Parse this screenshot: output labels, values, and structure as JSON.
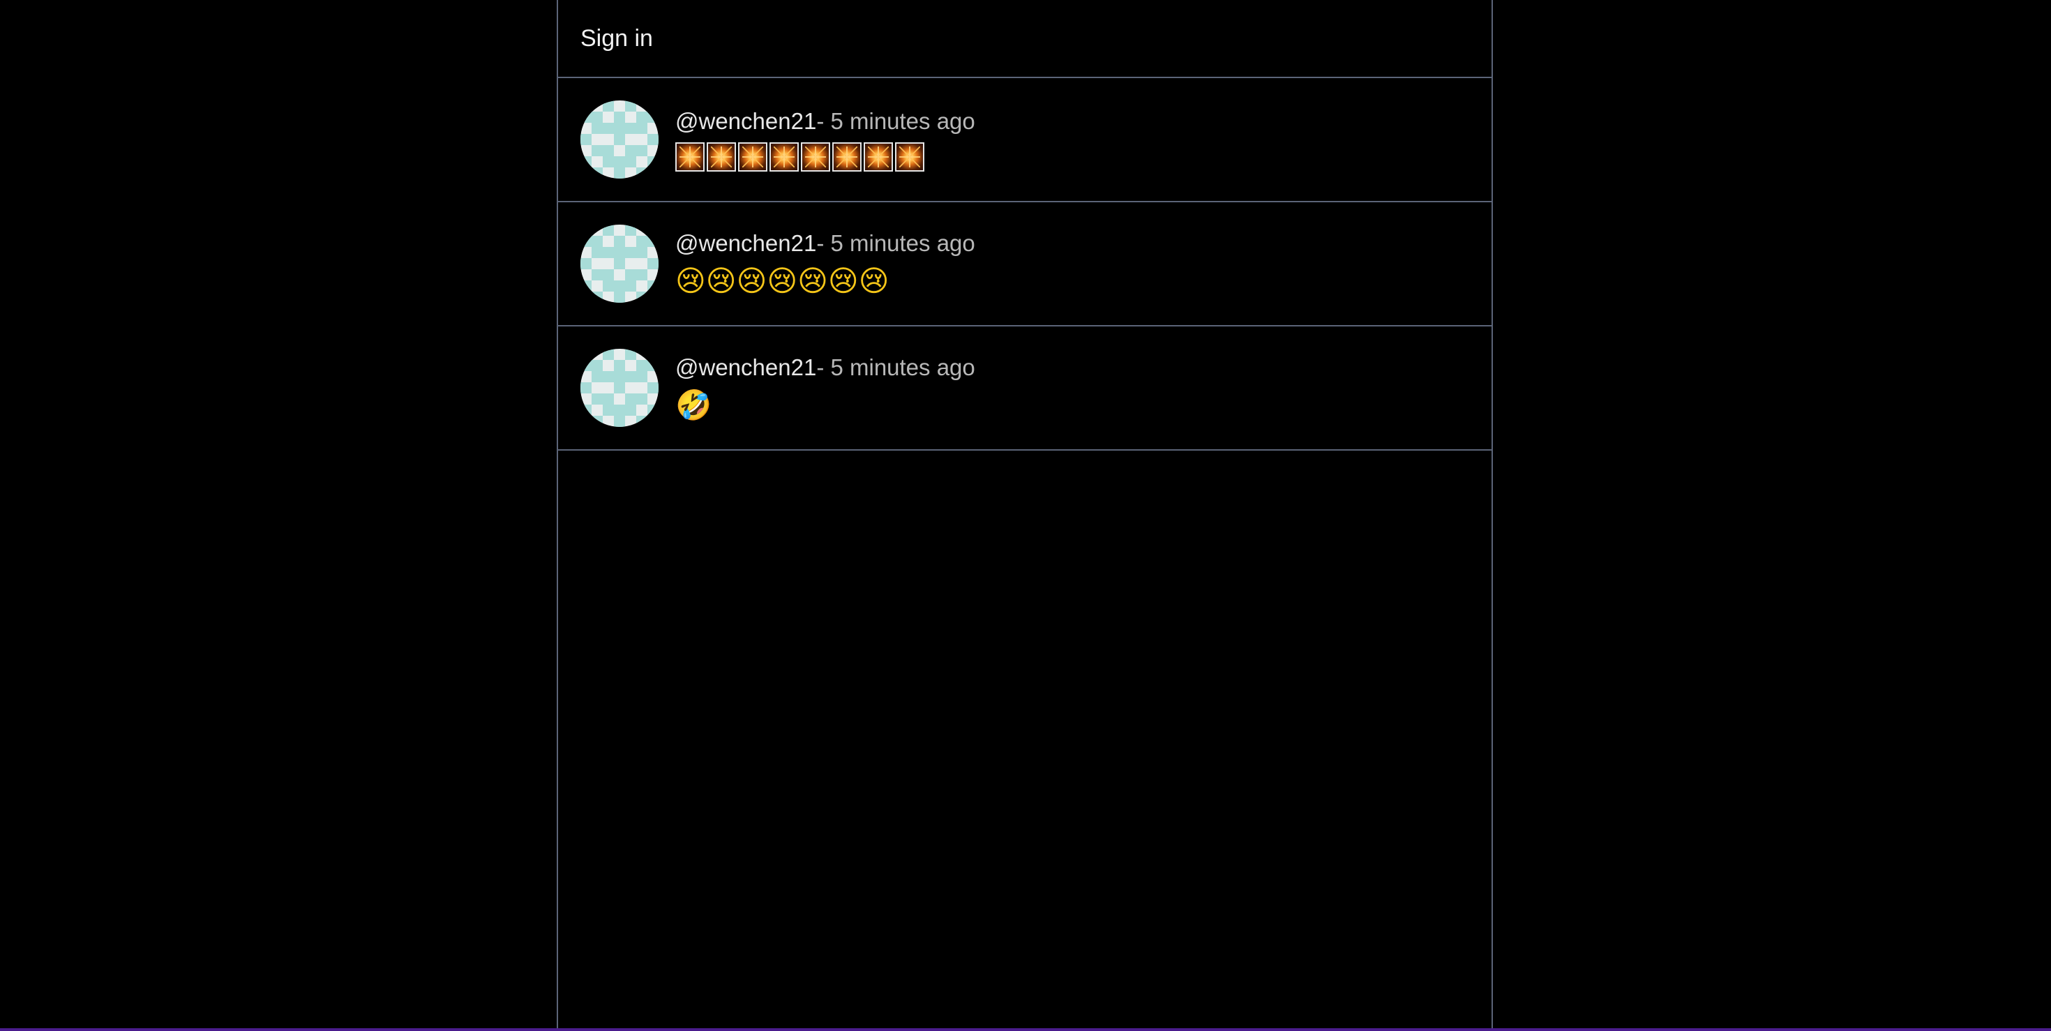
{
  "header": {
    "sign_in_label": "Sign in"
  },
  "posts": [
    {
      "author": "@wenchen21",
      "time": "- 5 minutes ago",
      "content_type": "boxed-emoji",
      "emoji_name": "sparkler-icon",
      "emoji_count": 8
    },
    {
      "author": "@wenchen21",
      "time": "- 5 minutes ago",
      "content_type": "emoji",
      "content": "😢😢😢😢😢😢😢"
    },
    {
      "author": "@wenchen21",
      "time": "- 5 minutes ago",
      "content_type": "emoji",
      "content": "🤣"
    }
  ],
  "colors": {
    "background": "#000000",
    "border": "#5b6478",
    "text": "#e8e8e8",
    "muted_text": "#b8b8b8",
    "avatar_teal": "#a8dcd8",
    "avatar_light": "#e8eeee",
    "bottom_accent": "#4a1c8c"
  }
}
